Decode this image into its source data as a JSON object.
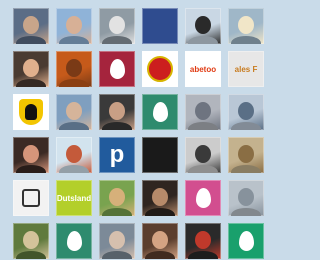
{
  "rows": [
    [
      {
        "kind": "photo",
        "colors": [
          "#5b6d86",
          "#c8a58a"
        ],
        "label": "avatar-photo"
      },
      {
        "kind": "photo",
        "colors": [
          "#8fb3d8",
          "#d7b096"
        ],
        "label": "avatar-photo"
      },
      {
        "kind": "photo",
        "colors": [
          "#8f9ba4",
          "#e2e2e2"
        ],
        "label": "avatar-photo"
      },
      {
        "kind": "logo",
        "colors": [
          "#2f4c8f",
          "#f2f2f2"
        ],
        "text": "",
        "label": "avatar-logo"
      },
      {
        "kind": "photo",
        "colors": [
          "#c9d7e4",
          "#2a2a2a"
        ],
        "label": "avatar-photo"
      },
      {
        "kind": "photo",
        "colors": [
          "#9fb7c8",
          "#f1e6c8"
        ],
        "label": "avatar-photo"
      }
    ],
    [
      {
        "kind": "photo",
        "colors": [
          "#4a3b32",
          "#e0b08d"
        ],
        "label": "avatar-photo"
      },
      {
        "kind": "photo",
        "colors": [
          "#c65a1a",
          "#7a3a16"
        ],
        "label": "avatar-photo"
      },
      {
        "kind": "egg",
        "colors": [
          "#a5243d"
        ],
        "label": "default-egg-avatar"
      },
      {
        "kind": "disc",
        "colors": [
          "#ffffff",
          "#cc1e1e"
        ],
        "label": "avatar-logo"
      },
      {
        "kind": "text",
        "colors": [
          "#ffffff",
          "#e03a12"
        ],
        "text": "abetoo",
        "label": "avatar-logo"
      },
      {
        "kind": "text",
        "colors": [
          "#e7e7e7",
          "#c87b1f"
        ],
        "text": "ales F",
        "label": "avatar-logo"
      }
    ],
    [
      {
        "kind": "eagle",
        "colors": [
          "#ffffff"
        ],
        "label": "avatar-coat-of-arms"
      },
      {
        "kind": "photo",
        "colors": [
          "#7f9fbf",
          "#d5b49a"
        ],
        "label": "avatar-photo"
      },
      {
        "kind": "photo",
        "colors": [
          "#3a3a3a",
          "#c89f85"
        ],
        "label": "avatar-photo"
      },
      {
        "kind": "egg",
        "colors": [
          "#2e8b6e"
        ],
        "label": "default-egg-avatar"
      },
      {
        "kind": "photo",
        "colors": [
          "#b1b5bd",
          "#6e7480"
        ],
        "label": "avatar-photo"
      },
      {
        "kind": "photo",
        "colors": [
          "#b9c7d6",
          "#5a6f86"
        ],
        "label": "avatar-photo"
      }
    ],
    [
      {
        "kind": "photo",
        "colors": [
          "#3b2a24",
          "#d5957a"
        ],
        "label": "avatar-photo"
      },
      {
        "kind": "photo",
        "colors": [
          "#d2e3ee",
          "#c45a3a"
        ],
        "label": "avatar-photo"
      },
      {
        "kind": "letter",
        "colors": [
          "#215b9d"
        ],
        "text": "p",
        "label": "avatar-logo"
      },
      {
        "kind": "text",
        "colors": [
          "#1a1a1a",
          "#cfcfcf"
        ],
        "text": "",
        "label": "avatar-logo"
      },
      {
        "kind": "photo",
        "colors": [
          "#cccccc",
          "#3a3a3a"
        ],
        "label": "avatar-photo"
      },
      {
        "kind": "photo",
        "colors": [
          "#c4b28e",
          "#8a6e44"
        ],
        "label": "avatar-photo"
      }
    ],
    [
      {
        "kind": "bear",
        "colors": [
          "#f2f2f2"
        ],
        "label": "avatar-coat-of-arms"
      },
      {
        "kind": "text",
        "colors": [
          "#b3cf2a",
          "#ffffff"
        ],
        "text": "Dutsland",
        "label": "avatar-logo"
      },
      {
        "kind": "photo",
        "colors": [
          "#79a34f",
          "#d6b07a"
        ],
        "label": "avatar-photo"
      },
      {
        "kind": "photo",
        "colors": [
          "#2f2520",
          "#b68a6a"
        ],
        "label": "avatar-photo"
      },
      {
        "kind": "egg",
        "colors": [
          "#d24e8f"
        ],
        "label": "default-egg-avatar"
      },
      {
        "kind": "photo",
        "colors": [
          "#b9c2ca",
          "#87929c"
        ],
        "label": "avatar-photo"
      }
    ],
    [
      {
        "kind": "photo",
        "colors": [
          "#5f7a3d",
          "#d4c39a"
        ],
        "label": "avatar-photo"
      },
      {
        "kind": "egg",
        "colors": [
          "#2e8b6e"
        ],
        "label": "default-egg-avatar"
      },
      {
        "kind": "photo",
        "colors": [
          "#7c8a98",
          "#d6c0ae"
        ],
        "label": "avatar-photo"
      },
      {
        "kind": "photo",
        "colors": [
          "#5b3e2e",
          "#d4a383"
        ],
        "label": "avatar-photo"
      },
      {
        "kind": "photo",
        "colors": [
          "#2a2a2a",
          "#c0392b"
        ],
        "label": "avatar-photo"
      },
      {
        "kind": "egg",
        "colors": [
          "#19a06c"
        ],
        "label": "default-egg-avatar"
      }
    ]
  ]
}
